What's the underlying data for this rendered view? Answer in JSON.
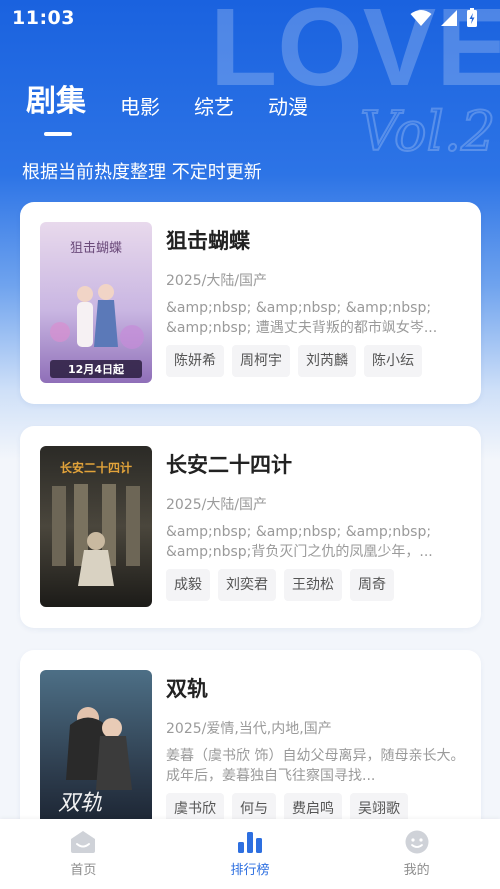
{
  "status_bar": {
    "time": "11:03"
  },
  "hero": {
    "deco_text": "LOVE",
    "deco_script": "Vol.2"
  },
  "tabs": [
    {
      "label": "剧集",
      "active": true
    },
    {
      "label": "电影",
      "active": false
    },
    {
      "label": "综艺",
      "active": false
    },
    {
      "label": "动漫",
      "active": false
    }
  ],
  "subtitle": "根据当前热度整理 不定时更新",
  "items": [
    {
      "title": "狙击蝴蝶",
      "meta": "2025/大陆/国产",
      "desc": "&amp;nbsp; &amp;nbsp; &amp;nbsp; &amp;nbsp; 遭遇丈夫背叛的都市飒女岑...",
      "tags": [
        "陈妍希",
        "周柯宇",
        "刘芮麟",
        "陈小纭"
      ],
      "poster": {
        "text": "狙击蝴蝶",
        "date": "12月4日起"
      }
    },
    {
      "title": "长安二十四计",
      "meta": "2025/大陆/国产",
      "desc": "&amp;nbsp; &amp;nbsp; &amp;nbsp; &amp;nbsp;背负灭门之仇的凤凰少年，...",
      "tags": [
        "成毅",
        "刘奕君",
        "王劲松",
        "周奇"
      ],
      "poster": {
        "text": "长安二十四计"
      }
    },
    {
      "title": "双轨",
      "meta": "2025/爱情,当代,内地,国产",
      "desc": "姜暮（虞书欣 饰）自幼父母离异，随母亲长大。成年后，姜暮独自飞往察国寻找...",
      "tags": [
        "虞书欣",
        "何与",
        "费启鸣",
        "吴翊歌"
      ],
      "poster": {
        "text": "双轨"
      }
    }
  ],
  "bottom_nav": [
    {
      "label": "首页",
      "icon": "home-icon",
      "active": false
    },
    {
      "label": "排行榜",
      "icon": "ranking-icon",
      "active": true
    },
    {
      "label": "我的",
      "icon": "profile-icon",
      "active": false
    }
  ],
  "colors": {
    "accent": "#2d6fe0",
    "hero_top": "#1a62df",
    "background": "#f3f6fb"
  }
}
